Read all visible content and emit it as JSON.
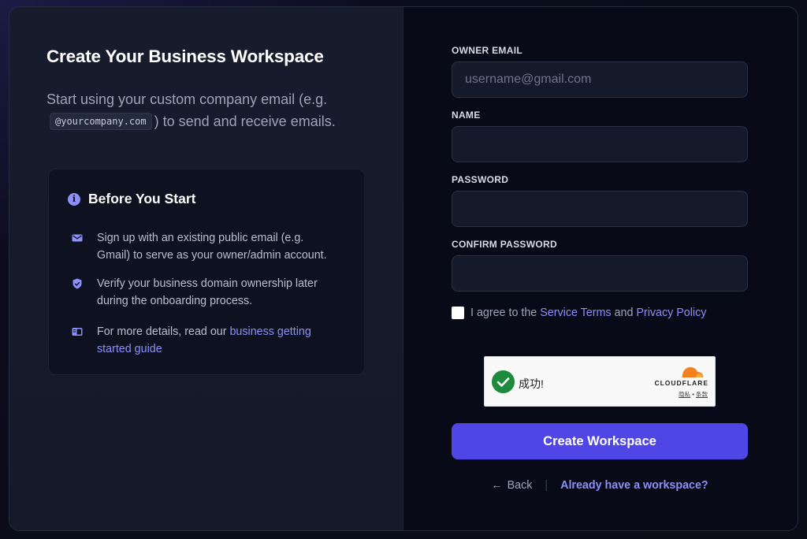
{
  "left": {
    "title": "Create Your Business Workspace",
    "subtitle_pre": "Start using your custom company email (e.g.",
    "subtitle_code": "@yourcompany.com",
    "subtitle_post": ") to send and receive emails.",
    "info_box": {
      "title": "Before You Start",
      "icon": "info-icon",
      "tips": [
        {
          "icon": "mail-icon",
          "text": "Sign up with an existing public email (e.g. Gmail) to serve as your owner/admin account."
        },
        {
          "icon": "shield-check-icon",
          "text": "Verify your business domain ownership later during the onboarding process."
        },
        {
          "icon": "book-icon",
          "text": "For more details, read our ",
          "link": "business getting started guide"
        }
      ]
    }
  },
  "form": {
    "owner_email": {
      "label": "OWNER EMAIL",
      "placeholder": "username@gmail.com",
      "value": ""
    },
    "name": {
      "label": "NAME",
      "placeholder": "",
      "value": ""
    },
    "password": {
      "label": "PASSWORD",
      "placeholder": "",
      "value": ""
    },
    "confirm_password": {
      "label": "CONFIRM PASSWORD",
      "placeholder": "",
      "value": ""
    },
    "agree": {
      "prefix": "I agree to the",
      "terms_link": "Service Terms",
      "middle": "and",
      "privacy_link": "Privacy Policy",
      "checked": false
    },
    "captcha": {
      "status": "成功!",
      "brand": "CLOUDFLARE",
      "privacy": "隐私",
      "dot": "•",
      "terms": "条款"
    },
    "submit_label": "Create Workspace",
    "back_label": "Back",
    "separator": "|",
    "login_label": "Already have a workspace?"
  },
  "colors": {
    "accent": "#8b8ff7",
    "primary_button": "#4f46e5",
    "success": "#1d8a3e",
    "cloudflare_orange": "#f38020"
  }
}
